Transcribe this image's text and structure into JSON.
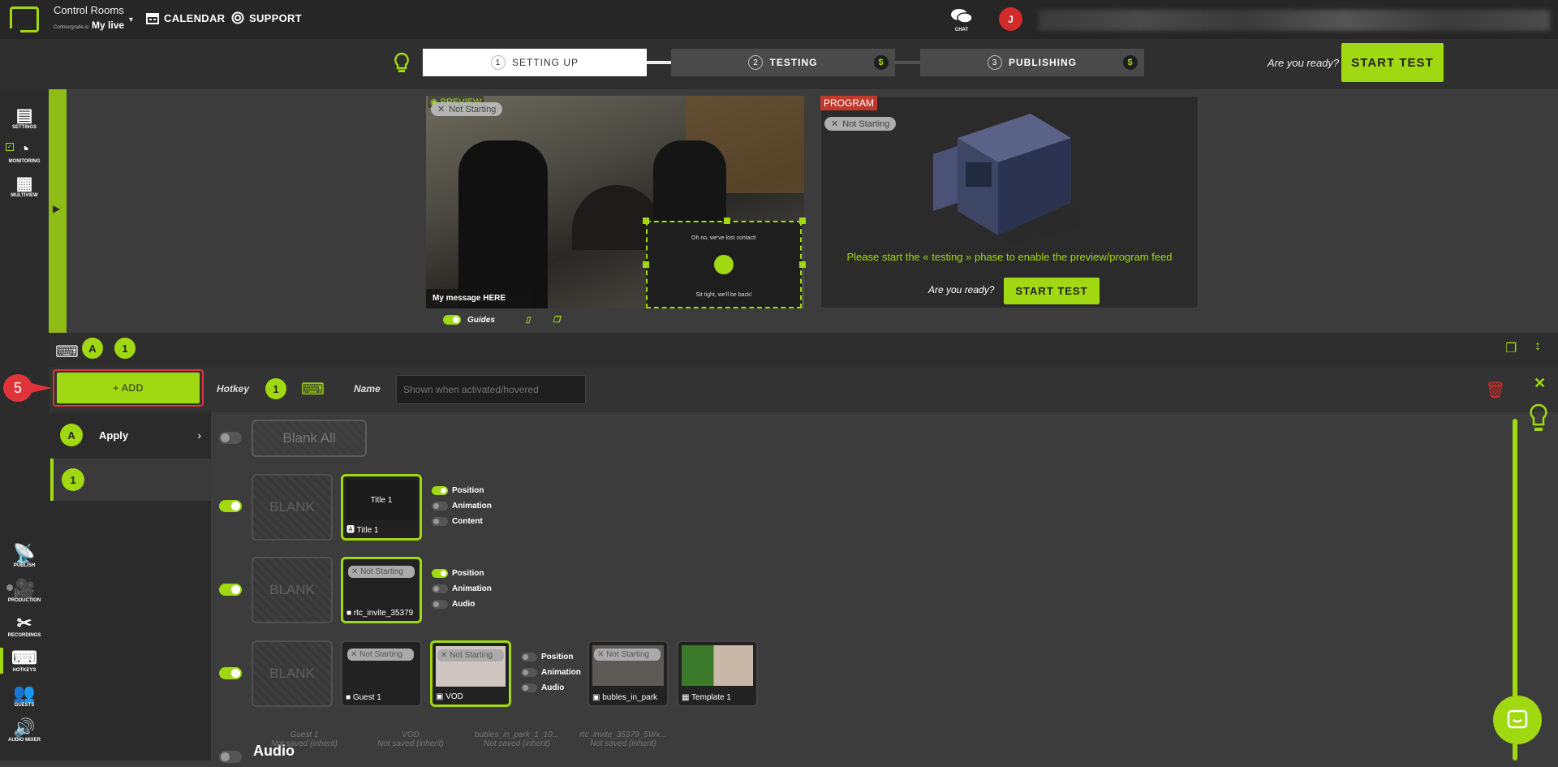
{
  "header": {
    "app_title": "Control Rooms",
    "live_brand": "Contourgrade.io",
    "live_name": "My live",
    "calendar": "CALENDAR",
    "support": "SUPPORT",
    "chat": "CHAT",
    "avatar_initial": "J"
  },
  "steps": [
    {
      "num": "1",
      "label": "SETTING UP"
    },
    {
      "num": "2",
      "label": "TESTING",
      "badge": "$"
    },
    {
      "num": "3",
      "label": "PUBLISHING",
      "badge": "$"
    }
  ],
  "ready_prompt": "Are you ready?",
  "start_test": "START TEST",
  "rail": {
    "settings": "SETTINGS",
    "monitoring": "MONITORING",
    "multiview": "MULTIVIEW",
    "publish": "PUBLISH",
    "production": "PRODUCTION",
    "recordings": "RECORDINGS",
    "hotkeys": "HOTKEYS",
    "guests": "GUESTS",
    "audio_mixer": "AUDIO MIXER"
  },
  "preview": {
    "label": "PREVIEW",
    "status": "Not Starting",
    "message": "My message HERE",
    "overlay_top": "Oh no, we've lost contact!",
    "overlay_bottom": "Sit tight, we'll be back!",
    "guides": "Guides"
  },
  "program": {
    "label": "PROGRAM",
    "status": "Not Starting",
    "message": "Please start the « testing » phase to enable the preview/program feed",
    "ready_prompt": "Are you ready?",
    "start_test": "START TEST"
  },
  "hotkey_bar": {
    "group_a": "A",
    "group_1": "1"
  },
  "editor": {
    "step_marker": "5",
    "add_label": "+ ADD",
    "hotkey_label": "Hotkey",
    "hotkey_value": "1",
    "name_label": "Name",
    "name_placeholder": "Shown when activated/hovered"
  },
  "list": {
    "apply_badge": "A",
    "apply_label": "Apply",
    "item_badge": "1"
  },
  "blank_all": "Blank All",
  "blank": "BLANK",
  "rows": [
    {
      "cards": [
        {
          "title": "Title 1",
          "caption": "Title 1"
        }
      ],
      "options": [
        "Position",
        "Animation",
        "Content"
      ]
    },
    {
      "cards": [
        {
          "status": "Not Starting",
          "caption": "rtc_invite_35379"
        }
      ],
      "options": [
        "Position",
        "Animation",
        "Audio"
      ]
    },
    {
      "cards": [
        {
          "status": "Not Starting",
          "caption": "Guest 1"
        },
        {
          "status": "Not Starting",
          "caption": "VOD"
        },
        {
          "status": "Not Starting",
          "caption": "bubles_in_park"
        },
        {
          "caption": "Template 1"
        }
      ],
      "options": [
        "Position",
        "Animation",
        "Audio"
      ]
    }
  ],
  "audio": {
    "label": "Audio",
    "cols": [
      {
        "name": "Guest 1",
        "state": "Not saved (inherit)"
      },
      {
        "name": "VOD",
        "state": "Not saved (inherit)"
      },
      {
        "name": "bubles_in_park_1_10...",
        "state": "Not saved (inherit)"
      },
      {
        "name": "rtc_invite_35379_5Wx...",
        "state": "Not saved (inherit)"
      }
    ]
  },
  "colors": {
    "accent": "#a0d911",
    "danger": "#e0333a",
    "program": "#c0392b"
  }
}
